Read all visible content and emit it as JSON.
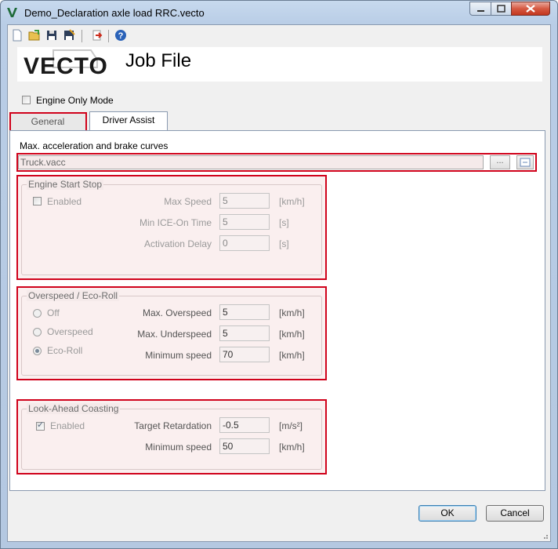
{
  "window": {
    "title": "Demo_Declaration axle load RRC.vecto"
  },
  "toolbar": {
    "icons": [
      "new-file-icon",
      "open-folder-icon",
      "save-icon",
      "save-as-icon",
      "send-to-job-list-icon",
      "help-icon"
    ]
  },
  "header": {
    "logo_text": "VECTO",
    "title": "Job File"
  },
  "engine_only_mode": {
    "label": "Engine Only Mode",
    "checked": false
  },
  "tabs": [
    {
      "label": "General",
      "active": false
    },
    {
      "label": "Driver Assist",
      "active": true
    }
  ],
  "accel_curves": {
    "label": "Max. acceleration and brake curves",
    "value": "Truck.vacc",
    "browse_label": "..."
  },
  "engine_start_stop": {
    "title": "Engine Start Stop",
    "enabled_label": "Enabled",
    "enabled": false,
    "fields": [
      {
        "label": "Max Speed",
        "value": "5",
        "unit": "[km/h]"
      },
      {
        "label": "Min ICE-On Time",
        "value": "5",
        "unit": "[s]"
      },
      {
        "label": "Activation Delay",
        "value": "0",
        "unit": "[s]"
      }
    ]
  },
  "overspeed": {
    "title": "Overspeed / Eco-Roll",
    "options": [
      {
        "label": "Off",
        "selected": false
      },
      {
        "label": "Overspeed",
        "selected": false
      },
      {
        "label": "Eco-Roll",
        "selected": true
      }
    ],
    "fields": [
      {
        "label": "Max. Overspeed",
        "value": "5",
        "unit": "[km/h]"
      },
      {
        "label": "Max. Underspeed",
        "value": "5",
        "unit": "[km/h]"
      },
      {
        "label": "Minimum speed",
        "value": "70",
        "unit": "[km/h]"
      }
    ]
  },
  "look_ahead": {
    "title": "Look-Ahead Coasting",
    "enabled_label": "Enabled",
    "enabled": true,
    "fields": [
      {
        "label": "Target Retardation",
        "value": "-0.5",
        "unit": "[m/s²]"
      },
      {
        "label": "Minimum speed",
        "value": "50",
        "unit": "[km/h]"
      }
    ]
  },
  "buttons": {
    "ok": "OK",
    "cancel": "Cancel"
  },
  "colors": {
    "highlight": "#d0021b",
    "logo_green": "#1f6b3a"
  }
}
